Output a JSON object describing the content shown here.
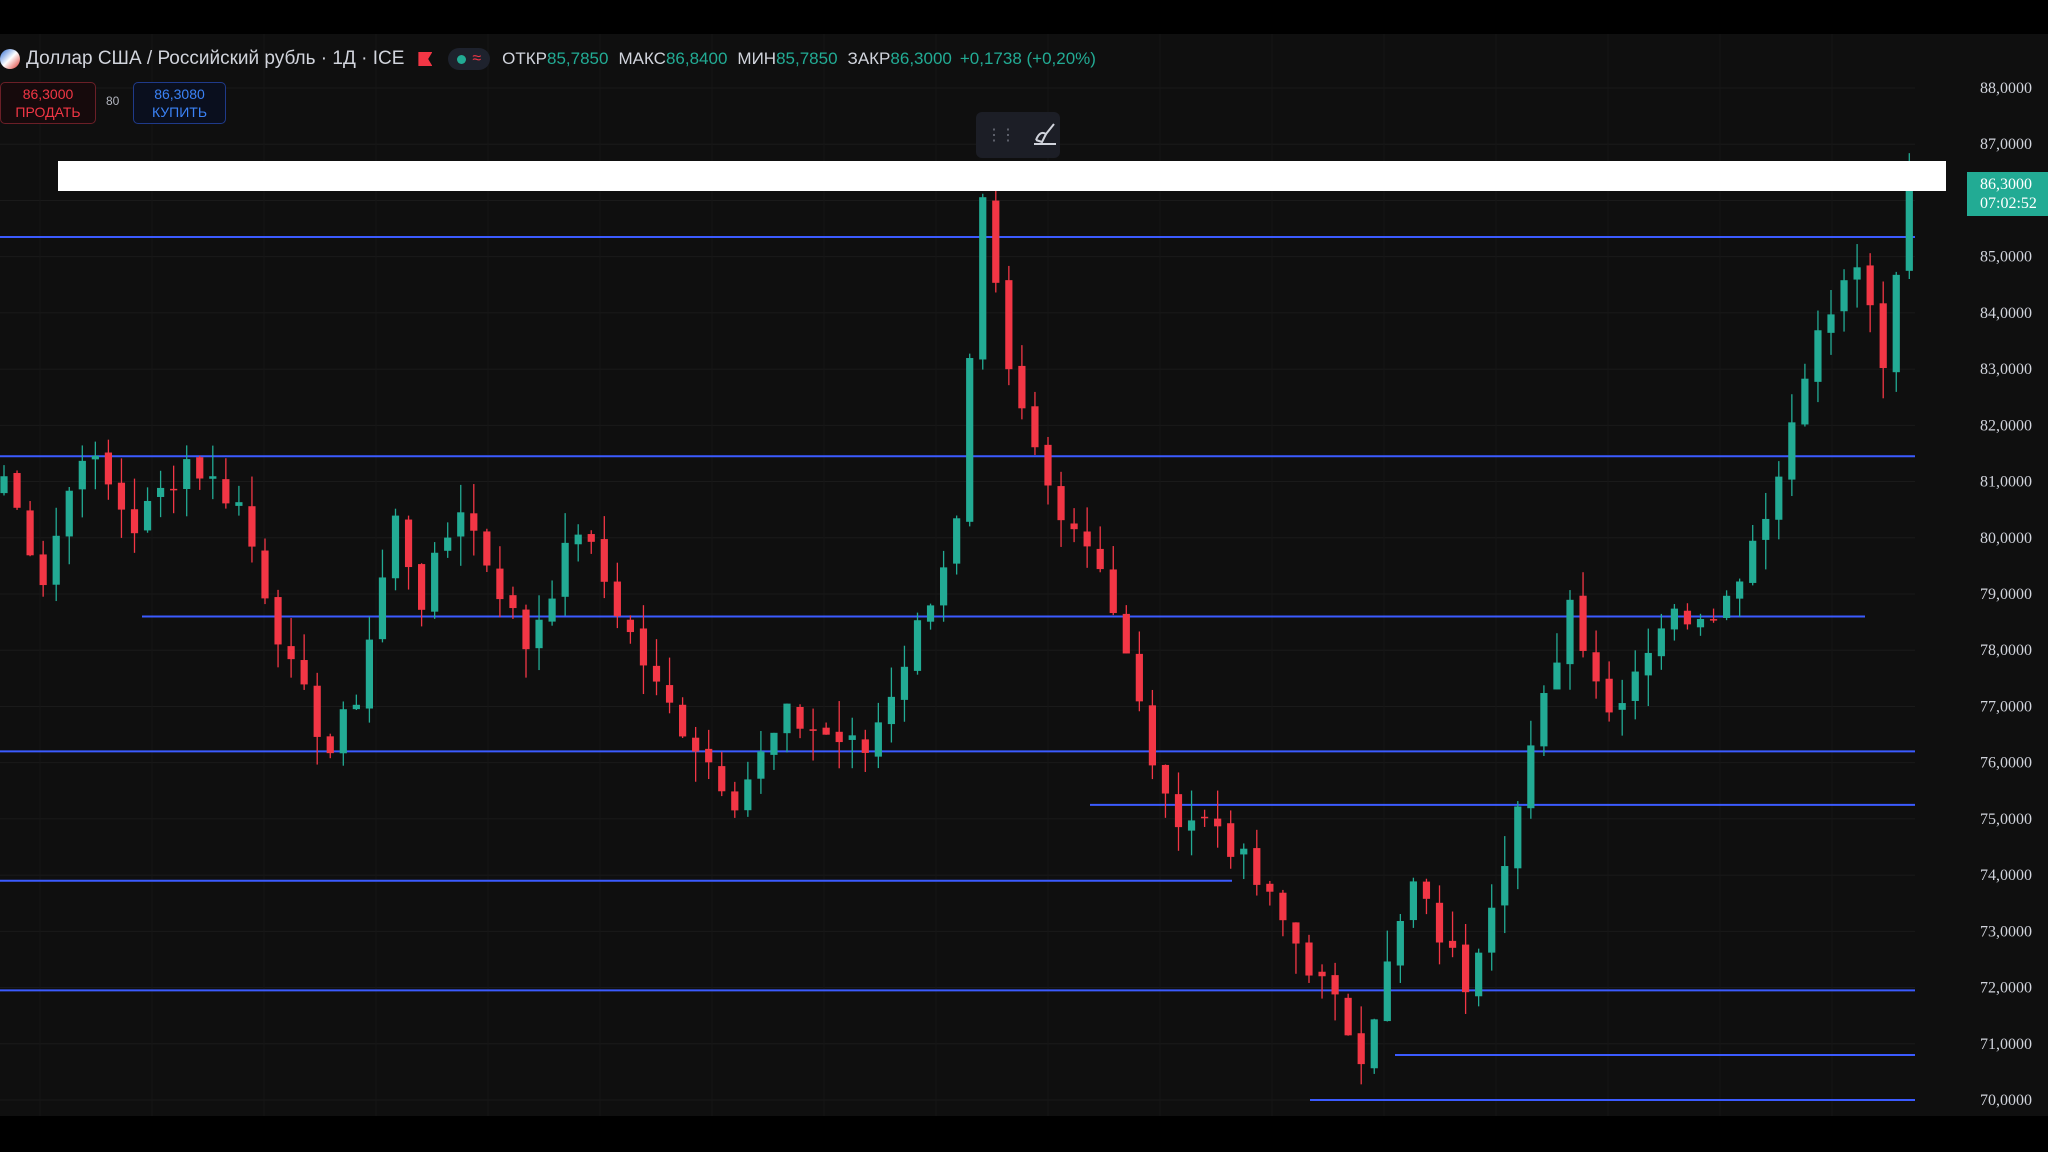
{
  "header": {
    "title": "Доллар США / Российский рубль · 1Д · ICE",
    "ohlc": [
      {
        "label": "ОТКР",
        "value": "85,7850"
      },
      {
        "label": "МАКС",
        "value": "86,8400"
      },
      {
        "label": "МИН",
        "value": "85,7850"
      },
      {
        "label": "ЗАКР",
        "value": "86,3000"
      }
    ],
    "change": "+0,1738 (+0,20%)"
  },
  "trade": {
    "sell_price": "86,3000",
    "sell_label": "ПРОДАТЬ",
    "spread": "80",
    "buy_price": "86,3080",
    "buy_label": "КУПИТЬ"
  },
  "price_tag": {
    "price": "86,3000",
    "countdown": "07:02:52"
  },
  "icons": {
    "symbol": "usd-rub-flag-icon",
    "flag": "red-flag-icon",
    "status": "market-status-dot-icon",
    "drag": "drag-handle-icon",
    "brush": "brush-icon"
  },
  "colors": {
    "up": "#22ab94",
    "down": "#f23645",
    "level_line": "#3b5bff",
    "background": "#0f0f0f",
    "axis_text": "#d1d4dc"
  },
  "chart_data": {
    "type": "candlestick",
    "y_ticks": [
      "88,0000",
      "87,0000",
      "86,0000",
      "85,0000",
      "84,0000",
      "83,0000",
      "82,0000",
      "81,0000",
      "80,0000",
      "79,0000",
      "78,0000",
      "77,0000",
      "76,0000",
      "75,0000",
      "74,0000",
      "73,0000",
      "72,0000",
      "71,0000",
      "70,0000"
    ],
    "ylim": [
      69.8,
      88.3
    ],
    "n_candles": 147,
    "anchors": [
      [
        0,
        81.1
      ],
      [
        3,
        79.3
      ],
      [
        6,
        81.6
      ],
      [
        10,
        80.2
      ],
      [
        14,
        81.4
      ],
      [
        18,
        80.6
      ],
      [
        22,
        77.6
      ],
      [
        25,
        76.2
      ],
      [
        27,
        77.2
      ],
      [
        30,
        80.3
      ],
      [
        32,
        78.9
      ],
      [
        35,
        80.6
      ],
      [
        40,
        78.1
      ],
      [
        44,
        80.2
      ],
      [
        50,
        77.3
      ],
      [
        56,
        75.4
      ],
      [
        60,
        76.8
      ],
      [
        66,
        76.2
      ],
      [
        70,
        78.4
      ],
      [
        73,
        80.2
      ],
      [
        75,
        85.8
      ],
      [
        77,
        82.8
      ],
      [
        80,
        80.9
      ],
      [
        84,
        79.6
      ],
      [
        89,
        75.2
      ],
      [
        93,
        74.9
      ],
      [
        99,
        72.8
      ],
      [
        104,
        70.9
      ],
      [
        108,
        73.8
      ],
      [
        112,
        72.1
      ],
      [
        116,
        75.2
      ],
      [
        120,
        78.9
      ],
      [
        123,
        76.9
      ],
      [
        127,
        78.5
      ],
      [
        132,
        78.9
      ],
      [
        136,
        81.1
      ],
      [
        138,
        83.1
      ],
      [
        142,
        84.9
      ],
      [
        144,
        82.9
      ],
      [
        146,
        86.3
      ]
    ],
    "levels": [
      85.35,
      81.45,
      78.6,
      76.2,
      75.25,
      73.9,
      71.95,
      70.8,
      70.0
    ],
    "last_price": 86.3
  }
}
